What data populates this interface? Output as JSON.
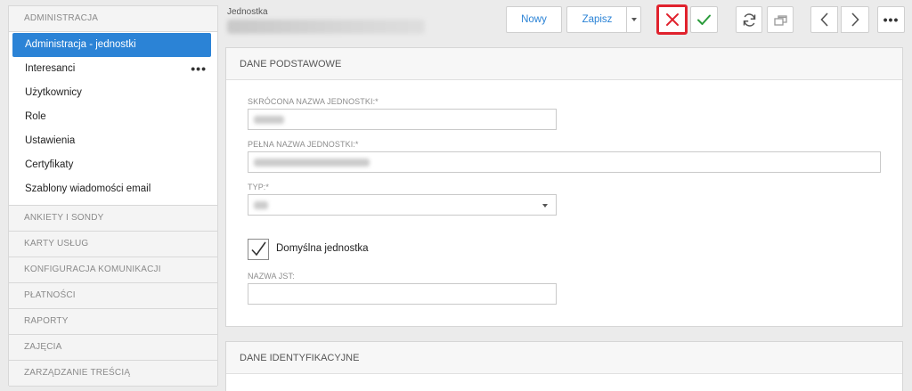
{
  "sidebar": {
    "admin_section": "ADMINISTRACJA",
    "items": [
      {
        "label": "Administracja - jednostki",
        "active": true
      },
      {
        "label": "Interesanci",
        "has_more": true
      },
      {
        "label": "Użytkownicy"
      },
      {
        "label": "Role"
      },
      {
        "label": "Ustawienia"
      },
      {
        "label": "Certyfikaty"
      },
      {
        "label": "Szablony wiadomości email"
      }
    ],
    "sections": [
      "ANKIETY I SONDY",
      "KARTY USŁUG",
      "KONFIGURACJA KOMUNIKACJI",
      "PŁATNOŚCI",
      "RAPORTY",
      "ZAJĘCIA",
      "ZARZĄDZANIE TREŚCIĄ"
    ],
    "more_glyph": "•••"
  },
  "header": {
    "label": "Jednostka"
  },
  "toolbar": {
    "new_label": "Nowy",
    "save_label": "Zapisz",
    "more_glyph": "•••",
    "accent": "#2b83d6",
    "cancel_color": "#e0222d",
    "ok_color": "#2a9b3a"
  },
  "panel_basic": {
    "title": "DANE PODSTAWOWE",
    "short_name_label": "SKRÓCONA NAZWA JEDNOSTKI:*",
    "full_name_label": "PEŁNA NAZWA JEDNOSTKI:*",
    "type_label": "TYP:*",
    "default_unit_label": "Domyślna jednostka",
    "default_unit_checked": true,
    "jst_label": "NAZWA JST:",
    "jst_value": ""
  },
  "panel_ident": {
    "title": "DANE IDENTYFIKACYJNE"
  }
}
